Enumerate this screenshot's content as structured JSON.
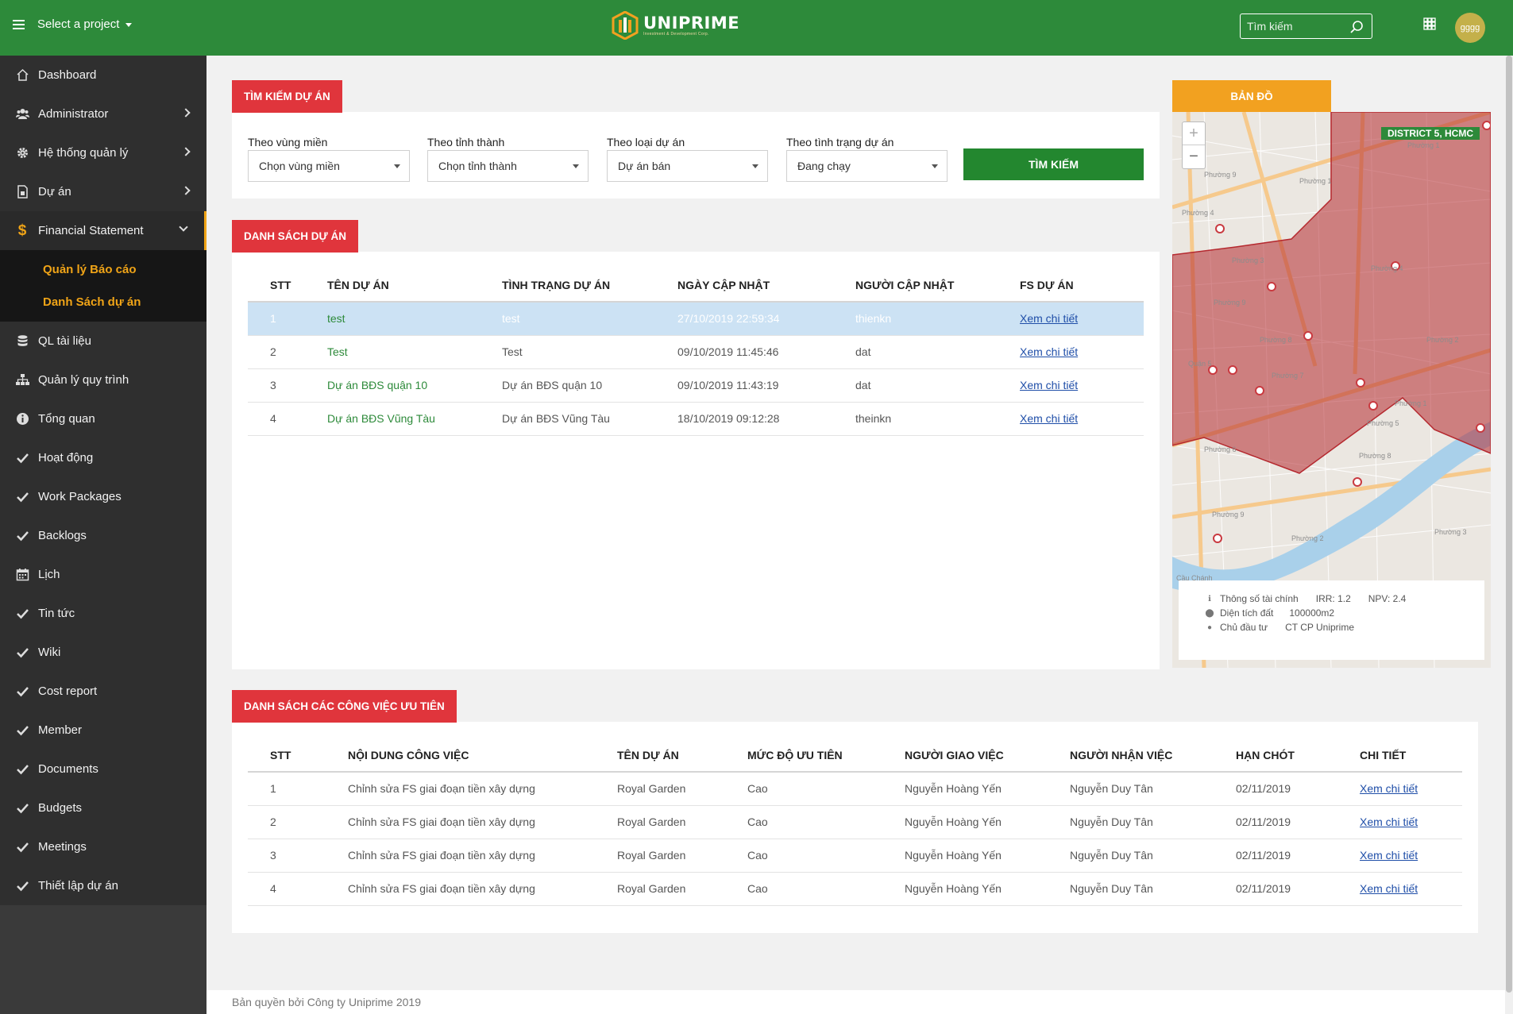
{
  "header": {
    "project_select": "Select a project",
    "logo_name": "UNIPRIME",
    "logo_tagline": "Investment & Development Corp.",
    "search_placeholder": "Tìm kiếm",
    "avatar_text": "gggg"
  },
  "sidebar": {
    "items": [
      {
        "label": "Dashboard",
        "icon": "home-icon"
      },
      {
        "label": "Administrator",
        "icon": "users-icon"
      },
      {
        "label": "Hệ thống quản lý",
        "icon": "gear-icon"
      },
      {
        "label": "Dự án",
        "icon": "document-icon"
      },
      {
        "label": "Financial Statement",
        "icon": "dollar-icon"
      },
      {
        "label": "QL tài liệu",
        "icon": "database-icon"
      },
      {
        "label": "Quản lý quy trình",
        "icon": "sitemap-icon"
      },
      {
        "label": "Tổng quan",
        "icon": "info-icon"
      },
      {
        "label": "Hoạt động",
        "icon": "check-icon"
      },
      {
        "label": "Work Packages",
        "icon": "check-icon"
      },
      {
        "label": "Backlogs",
        "icon": "check-icon"
      },
      {
        "label": "Lịch",
        "icon": "calendar-icon"
      },
      {
        "label": "Tin tức",
        "icon": "check-icon"
      },
      {
        "label": "Wiki",
        "icon": "check-icon"
      },
      {
        "label": "Cost report",
        "icon": "check-icon"
      },
      {
        "label": "Member",
        "icon": "check-icon"
      },
      {
        "label": "Documents",
        "icon": "check-icon"
      },
      {
        "label": "Budgets",
        "icon": "check-icon"
      },
      {
        "label": "Meetings",
        "icon": "check-icon"
      },
      {
        "label": "Thiết lập dự án",
        "icon": "check-icon"
      }
    ],
    "sub_items": [
      "Quản lý Báo cáo",
      "Danh Sách dự án"
    ]
  },
  "search_panel": {
    "title": "TÌM KIẾM DỰ ÁN",
    "filters": [
      {
        "label": "Theo vùng miền",
        "value": "Chọn vùng miền"
      },
      {
        "label": "Theo tỉnh thành",
        "value": "Chọn tỉnh thành"
      },
      {
        "label": "Theo loại dự án",
        "value": "Dự án bán"
      },
      {
        "label": "Theo tình trạng dự án",
        "value": "Đang chạy"
      }
    ],
    "button": "TÌM KIẾM"
  },
  "project_list": {
    "title": "DANH SÁCH DỰ ÁN",
    "columns": [
      "STT",
      "TÊN DỰ ÁN",
      "TÌNH TRẠNG DỰ ÁN",
      "NGÀY CẬP NHẬT",
      "NGƯỜI CẬP NHẬT",
      "FS DỰ ÁN"
    ],
    "rows": [
      [
        "1",
        "test",
        "test",
        "27/10/2019 22:59:34",
        "thienkn",
        "Xem chi tiết"
      ],
      [
        "2",
        "Test",
        "Test",
        "09/10/2019 11:45:46",
        "dat",
        "Xem chi tiết"
      ],
      [
        "3",
        "Dự án BĐS quận 10",
        "Dự án BĐS quận 10",
        "09/10/2019 11:43:19",
        "dat",
        "Xem chi tiết"
      ],
      [
        "4",
        "Dự án BĐS Vũng Tàu",
        "Dự án BĐS Vũng Tàu",
        "18/10/2019 09:12:28",
        "theinkn",
        "Xem chi tiết"
      ]
    ]
  },
  "map": {
    "title": "BẢN ĐỒ",
    "district": "DISTRICT 5, HCMC",
    "zoom_in": "+",
    "zoom_out": "−",
    "info": {
      "finance_label": "Thông số tài chính",
      "irr": "IRR: 1.2",
      "npv": "NPV: 2.4",
      "area_label": "Diện tích đất",
      "area_value": "100000m2",
      "owner_label": "Chủ đầu tư",
      "owner_value": "CT CP Uniprime"
    }
  },
  "task_list": {
    "title": "DANH SÁCH CÁC CÔNG VIỆC ƯU TIÊN",
    "columns": [
      "STT",
      "NỘI DUNG CÔNG VIỆC",
      "TÊN DỰ ÁN",
      "MỨC ĐỘ ƯU TIÊN",
      "NGƯỜI GIAO VIỆC",
      "NGƯỜI NHẬN VIỆC",
      "HẠN CHÓT",
      "CHI TIẾT"
    ],
    "rows": [
      [
        "1",
        "Chỉnh sửa FS giai đoạn tiền xây dựng",
        "Royal Garden",
        "Cao",
        "Nguyễn Hoàng Yến",
        "Nguyễn Duy Tân",
        "02/11/2019",
        "Xem chi tiết"
      ],
      [
        "2",
        "Chỉnh sửa FS giai đoạn tiền xây dựng",
        "Royal Garden",
        "Cao",
        "Nguyễn Hoàng Yến",
        "Nguyễn Duy Tân",
        "02/11/2019",
        "Xem chi tiết"
      ],
      [
        "3",
        "Chỉnh sửa FS giai đoạn tiền xây dựng",
        "Royal Garden",
        "Cao",
        "Nguyễn Hoàng Yến",
        "Nguyễn Duy Tân",
        "02/11/2019",
        "Xem chi tiết"
      ],
      [
        "4",
        "Chỉnh sửa FS giai đoạn tiền xây dựng",
        "Royal Garden",
        "Cao",
        "Nguyễn Hoàng Yến",
        "Nguyễn Duy Tân",
        "02/11/2019",
        "Xem chi tiết"
      ]
    ]
  },
  "footer": "Bản quyền bởi Công ty Uniprime 2019",
  "colors": {
    "header_green": "#2d8a3a",
    "accent_red": "#e0353c",
    "accent_orange": "#f2a120",
    "sidebar_dark": "#2f2f2f",
    "selected_row": "#cce2f4"
  }
}
